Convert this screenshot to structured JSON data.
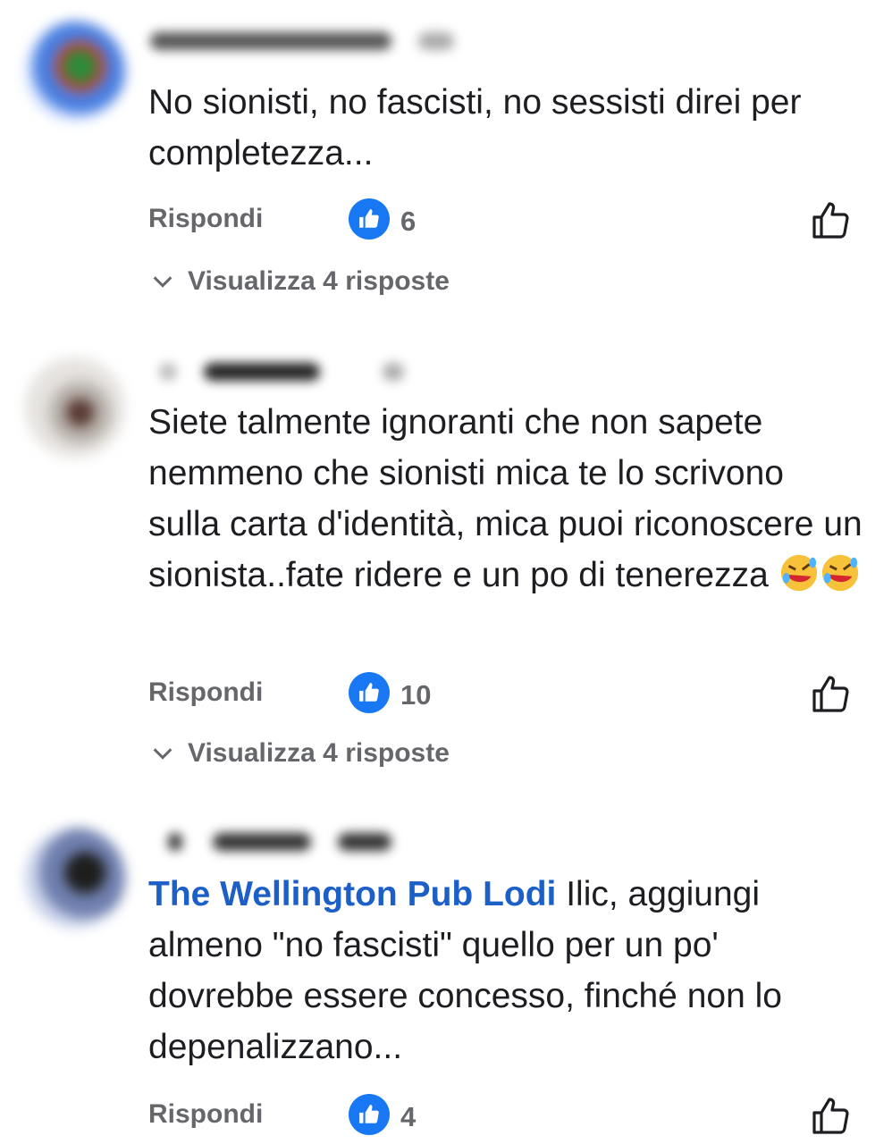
{
  "comments": [
    {
      "text": "No sionisti, no fascisti, no sessisti direi per completezza...",
      "reply_label": "Rispondi",
      "likes": "6",
      "replies_label": "Visualizza 4 risposte"
    },
    {
      "text": "Siete talmente  ignoranti che non sapete nemmeno  che sionisti mica te lo scrivono sulla carta  d'identità, mica puoi riconoscere un sionista..fate ridere e un po di tenerezza",
      "reply_label": "Rispondi",
      "likes": "10",
      "replies_label": "Visualizza 4 risposte"
    },
    {
      "mention": "The Wellington Pub Lodi",
      "text": " Ilic, aggiungi almeno \"no fascisti\" quello per un po' dovrebbe essere concesso, finché non lo depenalizzano...",
      "reply_label": "Rispondi",
      "likes": "4"
    }
  ],
  "colors": {
    "like_blue": "#1877f2",
    "mention_blue": "#1b5fc7",
    "secondary_text": "#65676b"
  },
  "icons": {
    "reaction": "thumbs-up-filled-icon",
    "like_action": "thumbs-up-outline-icon",
    "expand": "chevron-down-icon",
    "emoji": "rolling-on-floor-laughing-emoji"
  }
}
